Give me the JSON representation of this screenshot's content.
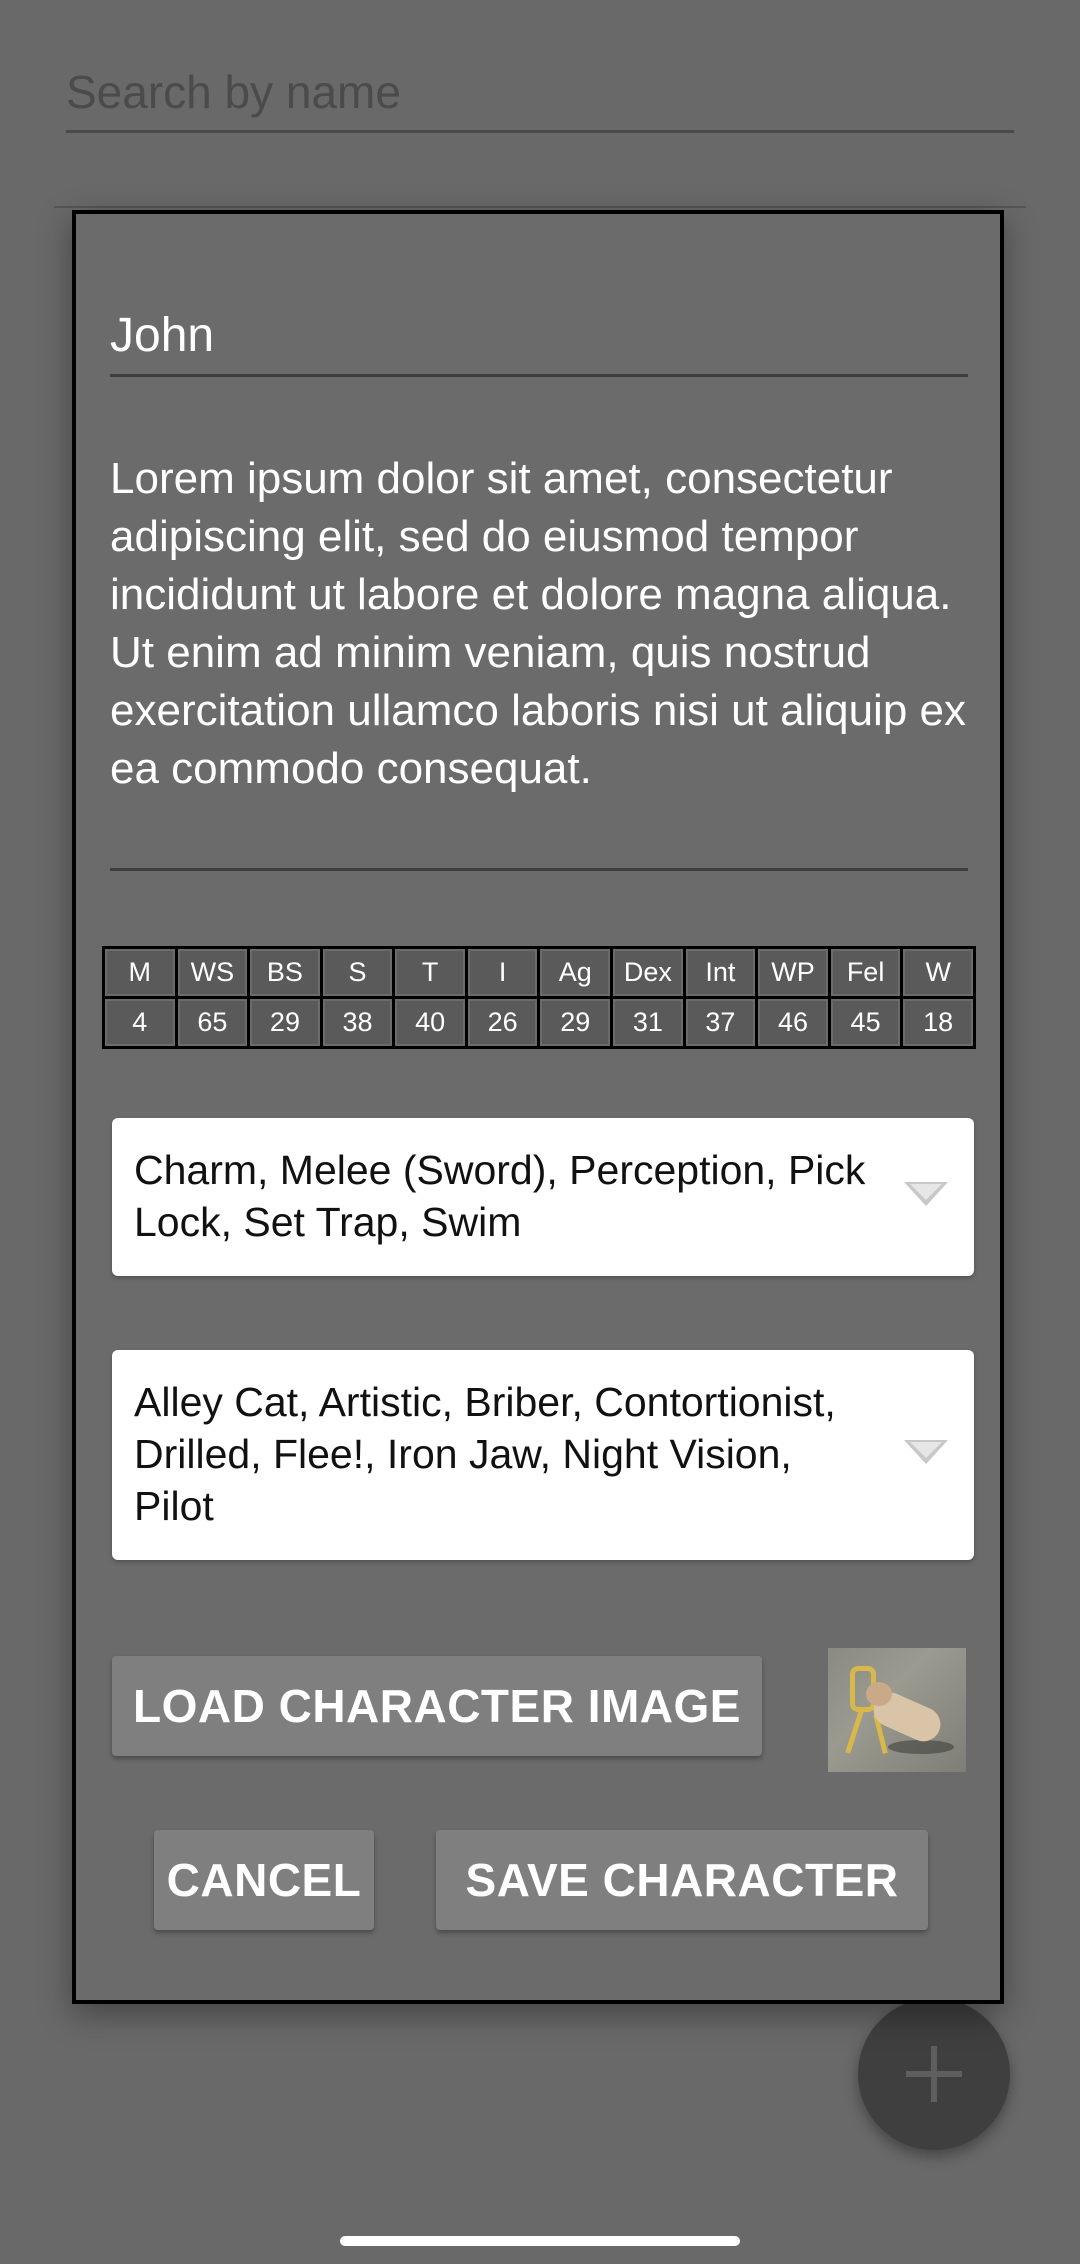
{
  "search": {
    "placeholder": "Search by name"
  },
  "dialog": {
    "name": "John",
    "description": "Lorem ipsum dolor sit amet, consectetur adipiscing elit, sed do eiusmod tempor incididunt ut labore et dolore magna aliqua. Ut enim ad minim veniam, quis nostrud exercitation ullamco laboris nisi ut aliquip ex ea commodo consequat.",
    "stats": {
      "headers": [
        "M",
        "WS",
        "BS",
        "S",
        "T",
        "I",
        "Ag",
        "Dex",
        "Int",
        "WP",
        "Fel",
        "W"
      ],
      "values": [
        "4",
        "65",
        "29",
        "38",
        "40",
        "26",
        "29",
        "31",
        "37",
        "46",
        "45",
        "18"
      ]
    },
    "skills_dropdown": {
      "selected": "Charm, Melee (Sword), Perception, Pick Lock, Set Trap, Swim",
      "icon": "chevron-down-icon"
    },
    "talents_dropdown": {
      "selected": "Alley Cat, Artistic, Briber, Contortionist, Drilled, Flee!, Iron Jaw, Night Vision, Pilot",
      "icon": "chevron-down-icon"
    },
    "load_image_label": "LOAD CHARACTER IMAGE",
    "cancel_label": "CANCEL",
    "save_label": "SAVE CHARACTER"
  },
  "fab": {
    "icon": "plus-icon"
  },
  "colors": {
    "scrim": "#696969",
    "dialog_bg": "#6b6b6b",
    "button_bg": "#7f7f7f",
    "text": "#ffffff",
    "fab_bg": "#3f3f3f"
  }
}
